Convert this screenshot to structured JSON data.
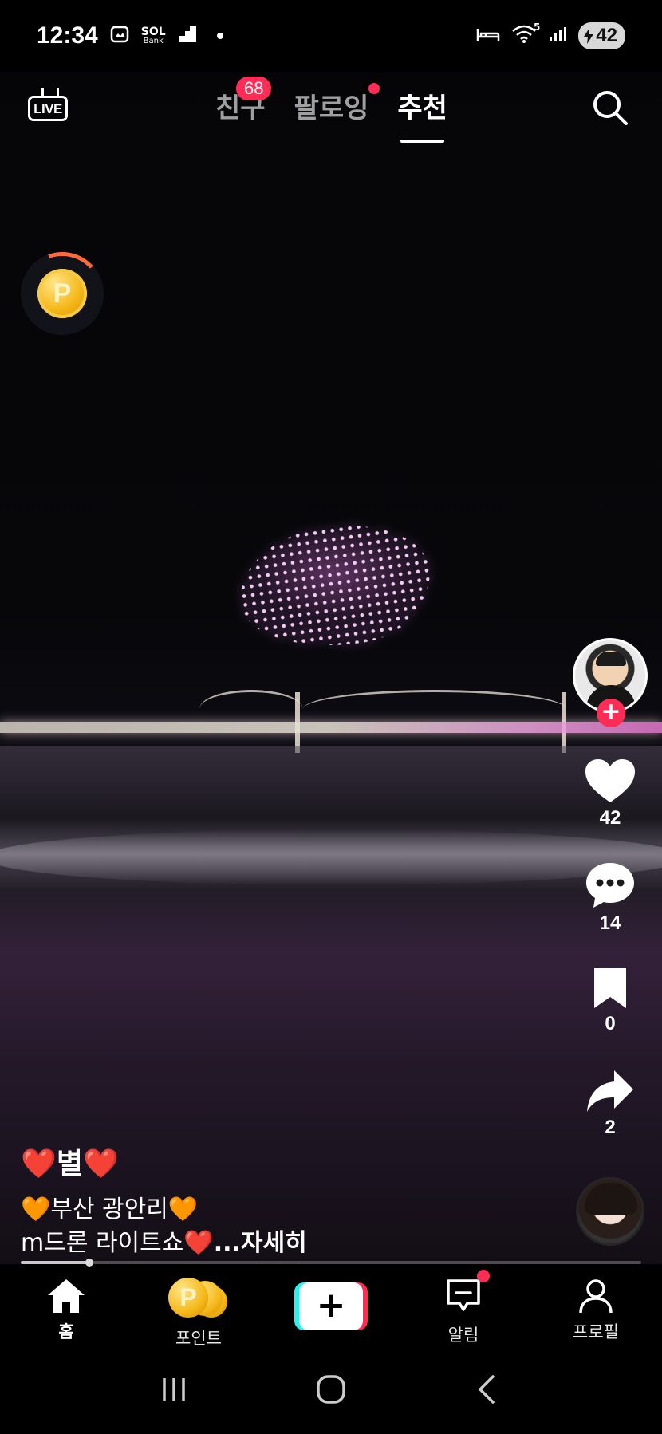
{
  "status_bar": {
    "time": "12:34",
    "bank_badge_top": "SOL",
    "bank_badge_bottom": "Bank",
    "battery": "42",
    "wifi_label": "5"
  },
  "top_nav": {
    "live_label": "LIVE",
    "tabs": [
      {
        "label": "친구",
        "badge": "68"
      },
      {
        "label": "팔로잉"
      },
      {
        "label": "추천"
      }
    ]
  },
  "right_rail": {
    "likes": "42",
    "comments": "14",
    "saves": "0",
    "shares": "2"
  },
  "caption": {
    "title": "❤️별❤️",
    "line1": "🧡부산 광안리🧡",
    "line2": "m드론 라이트쇼❤️",
    "more": "...자세히"
  },
  "progress": {
    "played_fraction": 0.11
  },
  "bottom_nav": {
    "home": "홈",
    "points": "포인트",
    "create": "+",
    "notifications": "알림",
    "profile": "프로필"
  },
  "colors": {
    "accent_red": "#ff2c55",
    "accent_cyan": "#25f4ee",
    "coin_gold": "#f5b819"
  }
}
